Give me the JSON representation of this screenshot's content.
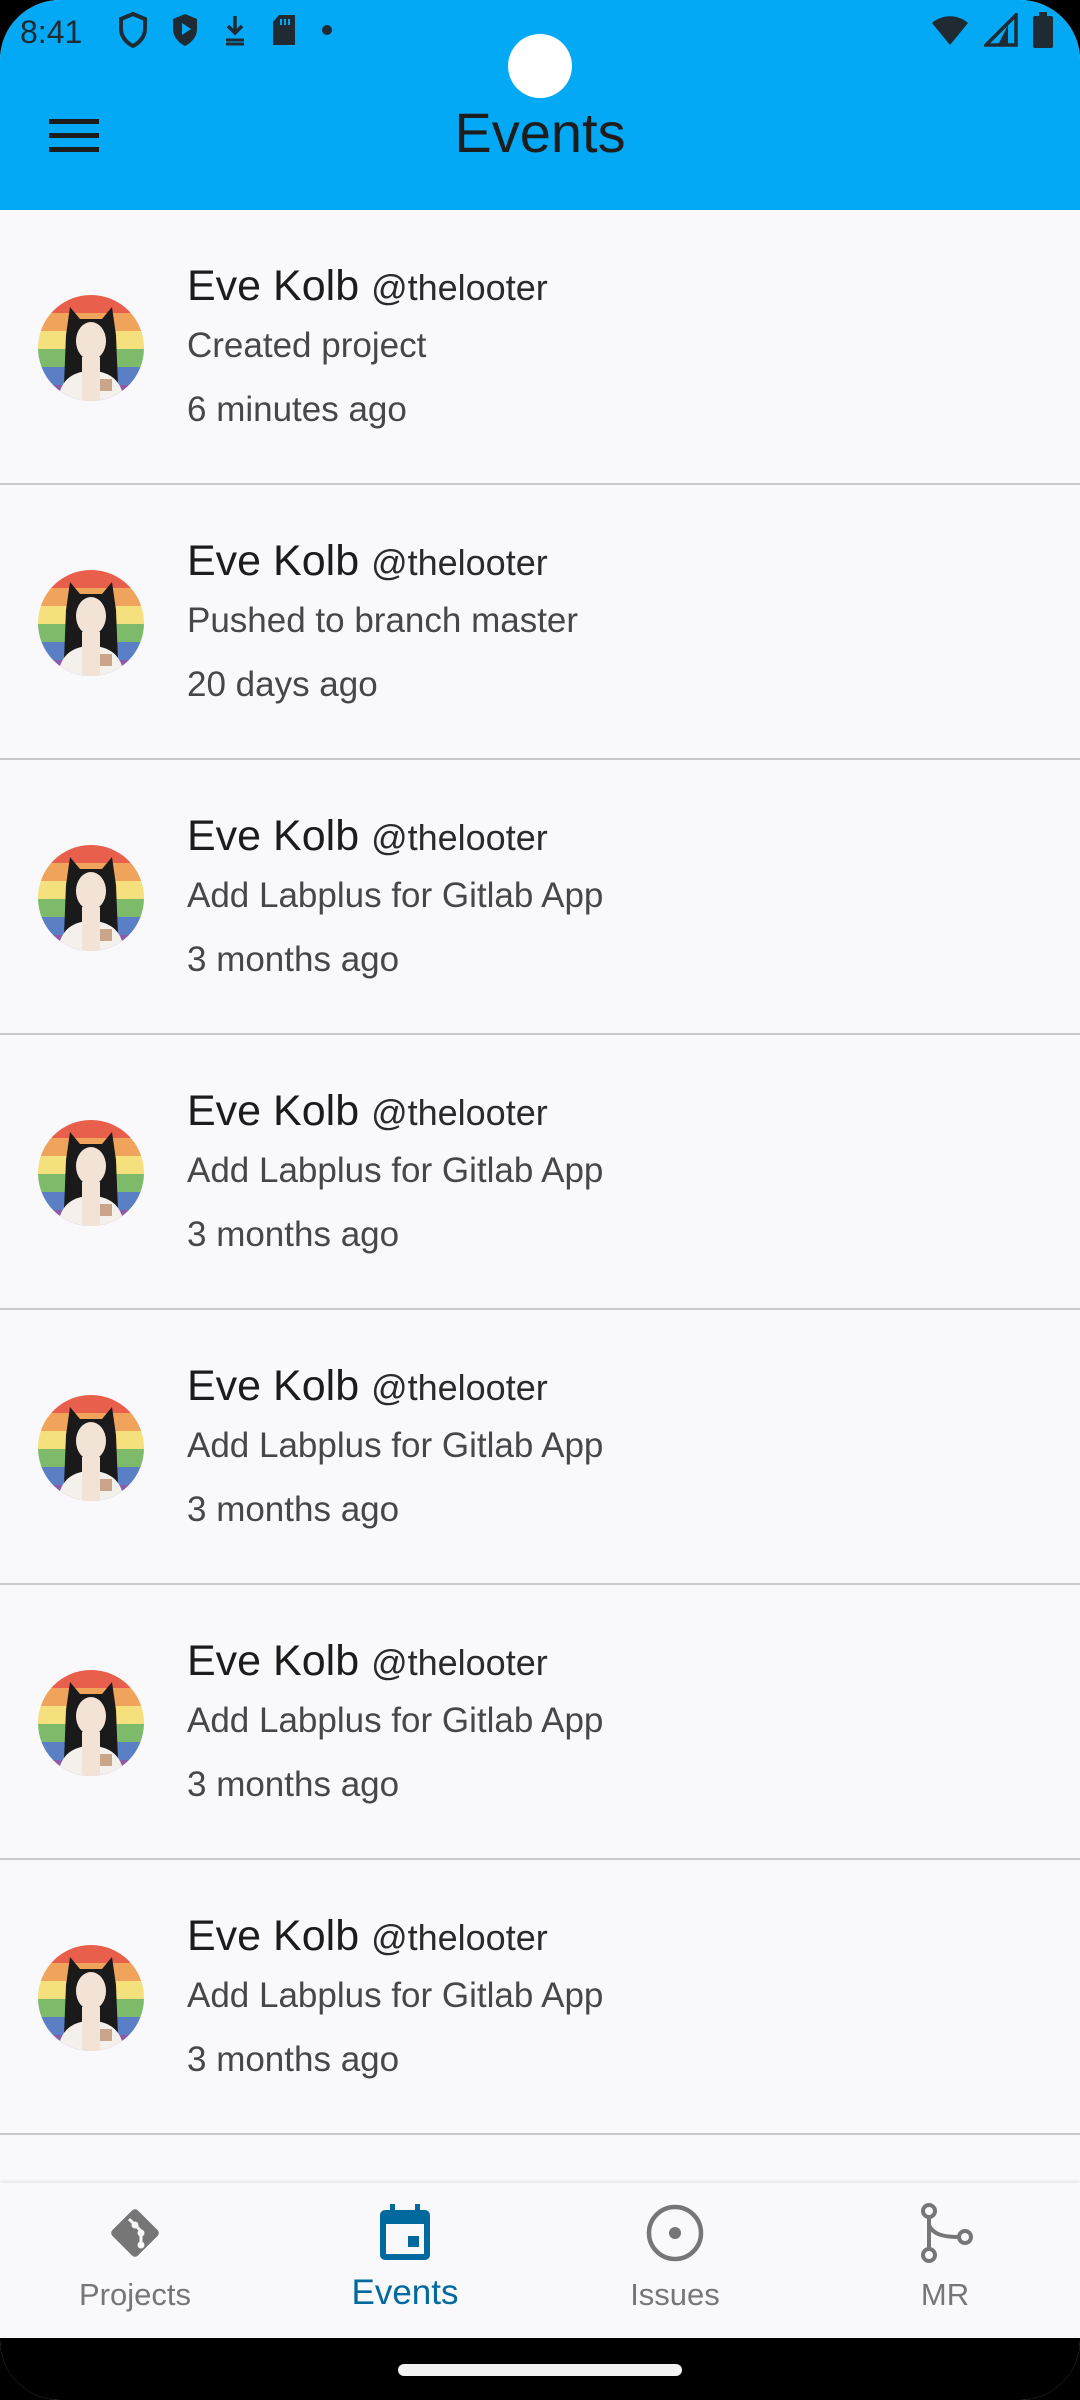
{
  "status_bar": {
    "time": "8:41",
    "left_icons": [
      "shield-icon",
      "play-protect-icon",
      "download-icon",
      "sd-card-icon",
      "dot-icon"
    ],
    "right_icons": [
      "wifi-icon",
      "signal-icon",
      "battery-icon"
    ]
  },
  "app_bar": {
    "title": "Events",
    "menu_icon": "hamburger-menu-icon",
    "color": "#03a9f4"
  },
  "events": [
    {
      "name": "Eve Kolb",
      "handle": "@thelooter",
      "action": "Created project",
      "time": "6 minutes ago"
    },
    {
      "name": "Eve Kolb",
      "handle": "@thelooter",
      "action": "Pushed to branch master",
      "time": "20 days ago"
    },
    {
      "name": "Eve Kolb",
      "handle": "@thelooter",
      "action": "Add Labplus for Gitlab App",
      "time": "3 months ago"
    },
    {
      "name": "Eve Kolb",
      "handle": "@thelooter",
      "action": "Add Labplus for Gitlab App",
      "time": "3 months ago"
    },
    {
      "name": "Eve Kolb",
      "handle": "@thelooter",
      "action": "Add Labplus for Gitlab App",
      "time": "3 months ago"
    },
    {
      "name": "Eve Kolb",
      "handle": "@thelooter",
      "action": "Add Labplus for Gitlab App",
      "time": "3 months ago"
    },
    {
      "name": "Eve Kolb",
      "handle": "@thelooter",
      "action": "Add Labplus for Gitlab App",
      "time": "3 months ago"
    }
  ],
  "bottom_nav": {
    "items": [
      {
        "label": "Projects",
        "icon": "git-icon",
        "active": false
      },
      {
        "label": "Events",
        "icon": "calendar-icon",
        "active": true
      },
      {
        "label": "Issues",
        "icon": "issue-circle-icon",
        "active": false
      },
      {
        "label": "MR",
        "icon": "merge-request-icon",
        "active": false
      }
    ],
    "active_color": "#01699e",
    "inactive_color": "#767676"
  }
}
